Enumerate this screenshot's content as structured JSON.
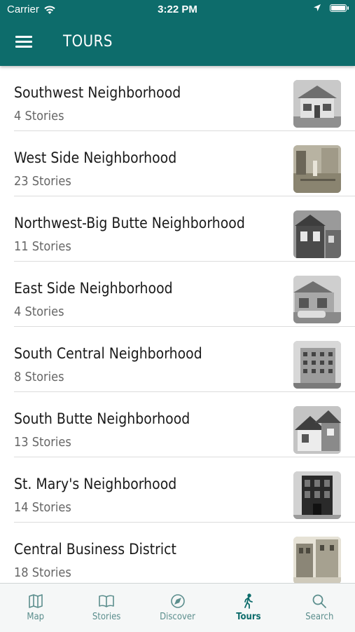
{
  "status": {
    "carrier": "Carrier",
    "time": "3:22 PM"
  },
  "header": {
    "title": "TOURS"
  },
  "tours": [
    {
      "name": "Southwest Neighborhood",
      "count": "4 Stories"
    },
    {
      "name": "West Side Neighborhood",
      "count": "23 Stories"
    },
    {
      "name": "Northwest-Big Butte Neighborhood",
      "count": "11 Stories"
    },
    {
      "name": "East Side Neighborhood",
      "count": "4 Stories"
    },
    {
      "name": "South Central Neighborhood",
      "count": "8 Stories"
    },
    {
      "name": "South Butte Neighborhood",
      "count": "13 Stories"
    },
    {
      "name": "St. Mary's Neighborhood",
      "count": "14 Stories"
    },
    {
      "name": "Central Business District",
      "count": "18 Stories"
    }
  ],
  "tabs": [
    {
      "label": "Map",
      "icon": "map-icon"
    },
    {
      "label": "Stories",
      "icon": "book-icon"
    },
    {
      "label": "Discover",
      "icon": "compass-icon"
    },
    {
      "label": "Tours",
      "icon": "walking-icon"
    },
    {
      "label": "Search",
      "icon": "search-icon"
    }
  ],
  "active_tab": "Tours",
  "colors": {
    "brand": "#0d6c6b",
    "tab_inactive": "#5b8e8d",
    "tab_bar": "#f5f7f7"
  }
}
